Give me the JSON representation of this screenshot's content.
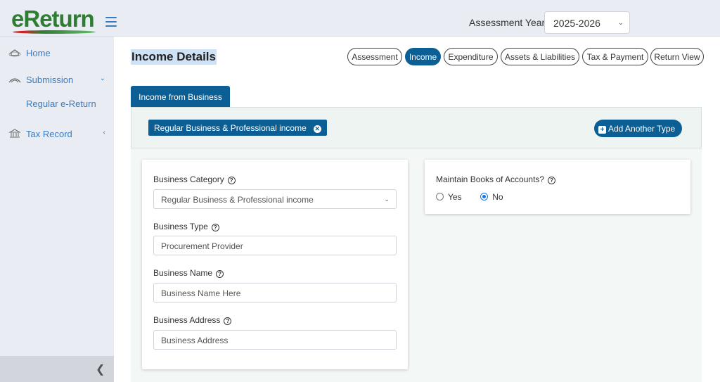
{
  "header": {
    "logo_e": "e",
    "logo_rest": "Return",
    "assessment_year_label": "Assessment Year",
    "assessment_year_value": "2025-2026"
  },
  "sidebar": {
    "items": [
      {
        "label": "Home",
        "icon": "home-icon"
      },
      {
        "label": "Submission",
        "icon": "submission-icon"
      },
      {
        "label": "Regular e-Return"
      },
      {
        "label": "Tax Record",
        "icon": "bank-icon"
      }
    ]
  },
  "main": {
    "title": "Income Details",
    "tabs": [
      "Assessment",
      "Income",
      "Expenditure",
      "Assets & Liabilities",
      "Tax & Payment",
      "Return View"
    ],
    "active_tab": "Income",
    "section_tab": "Income from Business",
    "chip_label": "Regular Business & Professional income",
    "add_button": "Add Another Type"
  },
  "form": {
    "business_category_label": "Business Category",
    "business_category_value": "Regular Business & Professional income",
    "business_type_label": "Business Type",
    "business_type_value": "Procurement Provider",
    "business_name_label": "Business Name",
    "business_name_placeholder": "Business Name Here",
    "business_address_label": "Business Address",
    "business_address_placeholder": "Business Address",
    "books_label": "Maintain Books of Accounts?",
    "yes_label": "Yes",
    "no_label": "No",
    "books_selected": "No"
  },
  "colors": {
    "primary": "#0b5f94",
    "link": "#3a7bbf",
    "logo_green": "#2e7d32",
    "logo_red": "#c62828"
  }
}
